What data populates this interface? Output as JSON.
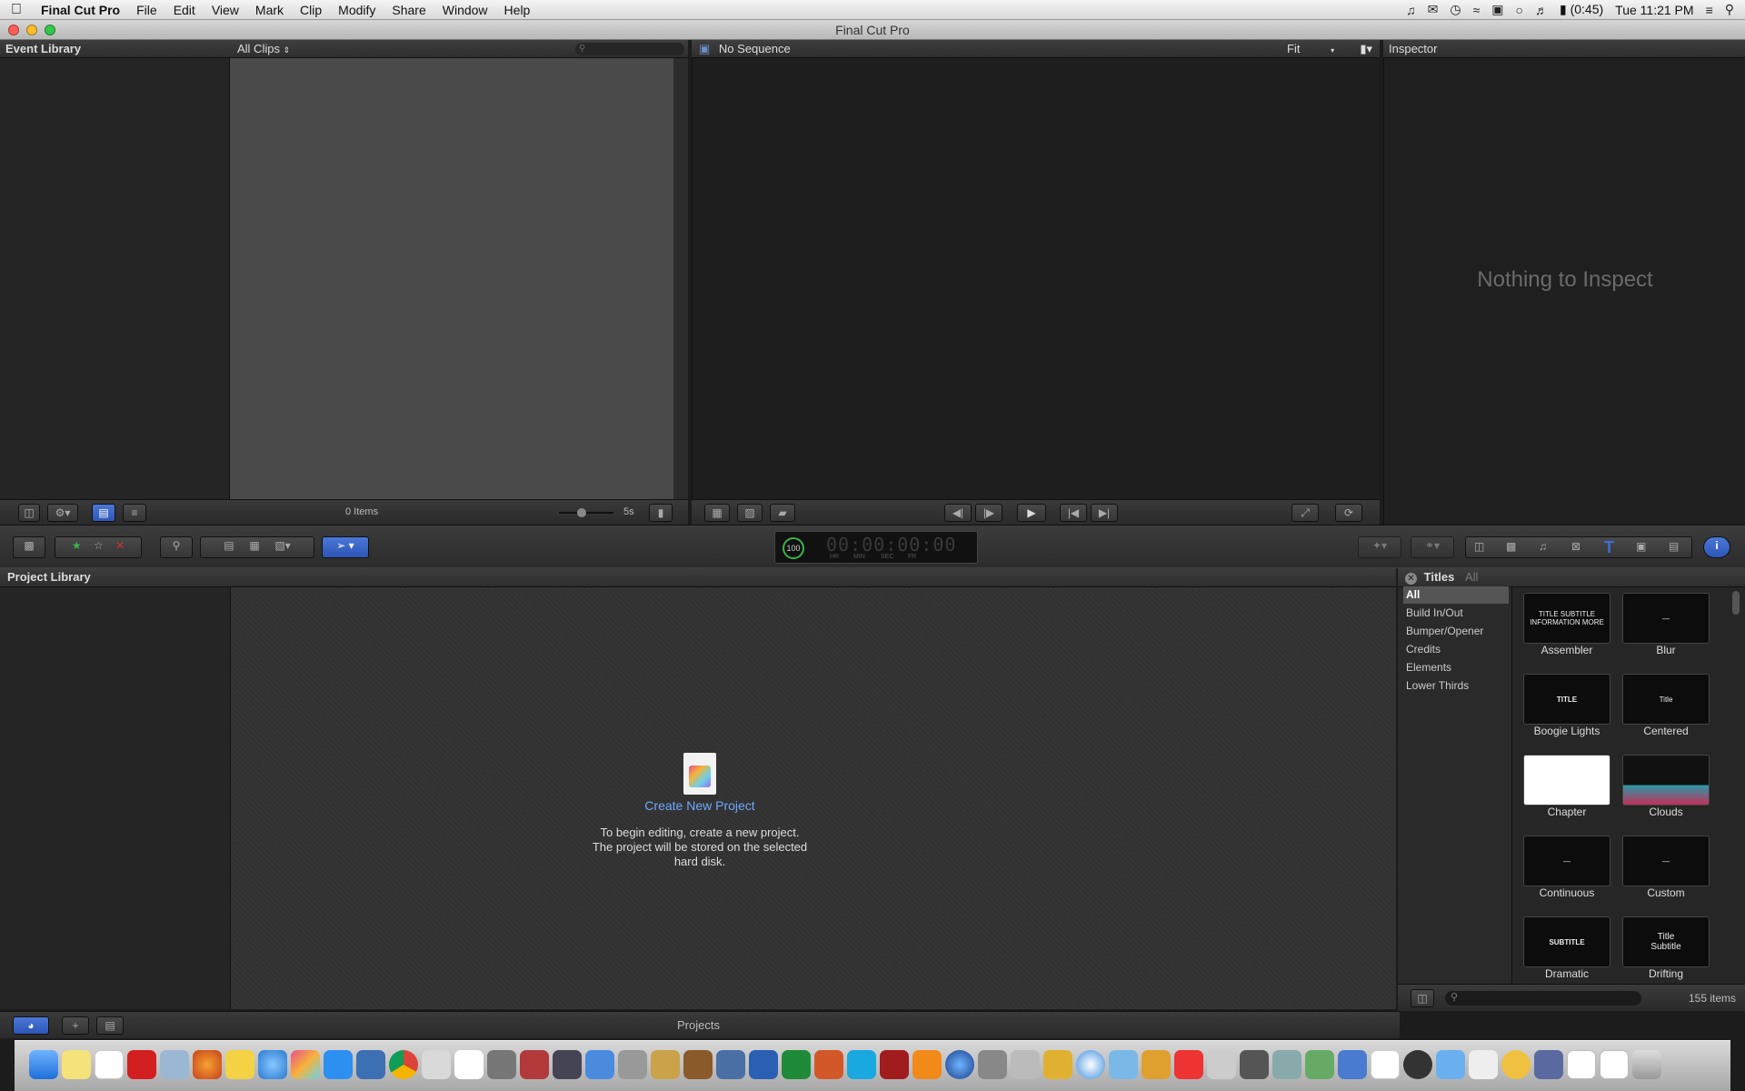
{
  "menubar": {
    "apple": "",
    "app_name": "Final Cut Pro",
    "items": [
      "File",
      "Edit",
      "View",
      "Mark",
      "Clip",
      "Modify",
      "Share",
      "Window",
      "Help"
    ],
    "battery": "(0:45)",
    "clock": "Tue 11:21 PM"
  },
  "window": {
    "title": "Final Cut Pro"
  },
  "event_library": {
    "title": "Event Library",
    "filter": "All Clips",
    "items_count": "0 Items",
    "duration": "5s"
  },
  "viewer": {
    "title": "No Sequence",
    "zoom": "Fit"
  },
  "inspector": {
    "title": "Inspector",
    "empty_message": "Nothing to Inspect"
  },
  "toolbar": {
    "timecode_percent": "100",
    "timecode": "00:00:00:00",
    "tc_labels": [
      "HR",
      "MIN",
      "SEC",
      "FR"
    ]
  },
  "project_library": {
    "title": "Project Library",
    "create_label": "Create New Project",
    "message_line1": "To begin editing, create a new project.",
    "message_line2": "The project will be stored on the selected",
    "message_line3": "hard disk.",
    "footer_label": "Projects"
  },
  "titles_browser": {
    "title": "Titles",
    "filter": "All",
    "categories": [
      "All",
      "Build In/Out",
      "Bumper/Opener",
      "Credits",
      "Elements",
      "Lower Thirds"
    ],
    "items": [
      {
        "name": "Assembler",
        "thumb_text": "TITLE SUBTITLE INFORMATION MORE"
      },
      {
        "name": "Blur",
        "thumb_text": "—"
      },
      {
        "name": "Boogie Lights",
        "thumb_text": "TITLE"
      },
      {
        "name": "Centered",
        "thumb_text": "Title"
      },
      {
        "name": "Chapter",
        "thumb_text": ""
      },
      {
        "name": "Clouds",
        "thumb_text": ""
      },
      {
        "name": "Continuous",
        "thumb_text": "—"
      },
      {
        "name": "Custom",
        "thumb_text": "—"
      },
      {
        "name": "Dramatic",
        "thumb_text": "SUBTITLE"
      },
      {
        "name": "Drifting",
        "thumb_text": "Title Subtitle"
      }
    ],
    "count": "155 items"
  },
  "colors": {
    "accent_blue": "#3d6fd4",
    "link_blue": "#6fa8ff"
  }
}
